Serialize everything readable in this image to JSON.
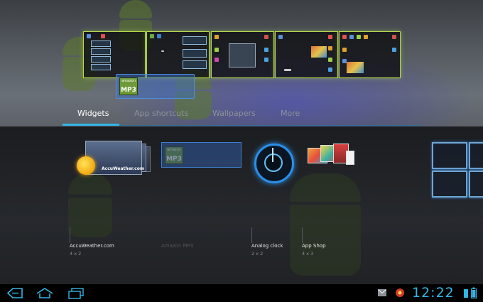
{
  "tabs": [
    {
      "label": "Widgets",
      "active": true
    },
    {
      "label": "App shortcuts",
      "active": false
    },
    {
      "label": "Wallpapers",
      "active": false
    },
    {
      "label": "More",
      "active": false
    }
  ],
  "home_preview": {
    "drag_item": {
      "badge_top": "amazon",
      "badge_bottom": "MP3"
    }
  },
  "widgets": [
    {
      "name": "AccuWeather.com",
      "size": "4 x 2",
      "preview_label": "AccuWeather.com",
      "icon": "accuweather-sun-icon"
    },
    {
      "name": "Amazon MP3",
      "size": "",
      "icon": "amazon-mp3-icon",
      "dimmed": true,
      "badge_top": "amazon",
      "badge_bottom": "MP3"
    },
    {
      "name": "Analog clock",
      "size": "2 x 2",
      "icon": "analog-clock-icon"
    },
    {
      "name": "App Shop",
      "size": "4 x 3",
      "icon": "app-shop-icon"
    }
  ],
  "system_bar": {
    "time": "12:22",
    "icons": [
      "back-icon",
      "home-icon",
      "recent-apps-icon",
      "gmail-icon",
      "notification-icon",
      "battery-icon"
    ]
  },
  "colors": {
    "accent": "#33b5e5",
    "panel_border": "#b8d94a"
  }
}
